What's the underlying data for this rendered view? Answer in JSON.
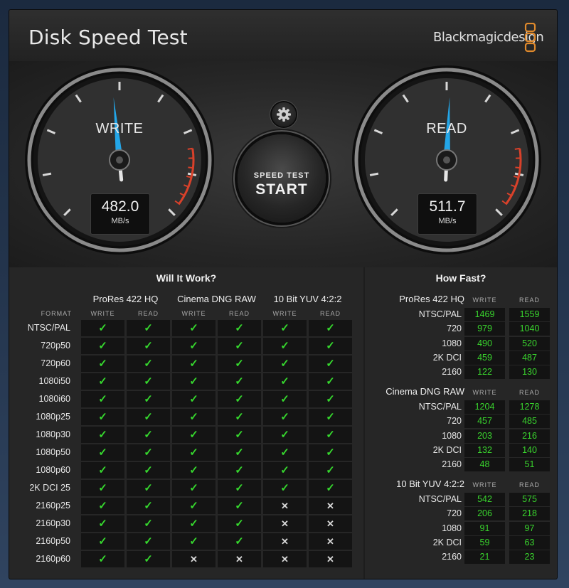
{
  "window": {
    "title": "Disk Speed Test",
    "brand": "Blackmagicdesign",
    "close_glyph": "×"
  },
  "gauges": {
    "write": {
      "label": "WRITE",
      "value": "482.0",
      "unit": "MB/s",
      "needle_fraction": 0.48
    },
    "read": {
      "label": "READ",
      "value": "511.7",
      "unit": "MB/s",
      "needle_fraction": 0.51
    }
  },
  "start_button": {
    "small": "SPEED TEST",
    "big": "START"
  },
  "settings_icon": "gear-icon",
  "will_it_work": {
    "title": "Will It Work?",
    "format_label": "FORMAT",
    "groups": [
      "ProRes 422 HQ",
      "Cinema DNG RAW",
      "10 Bit YUV 4:2:2"
    ],
    "sub": [
      "WRITE",
      "READ"
    ],
    "rows": [
      {
        "name": "NTSC/PAL",
        "v": [
          1,
          1,
          1,
          1,
          1,
          1
        ]
      },
      {
        "name": "720p50",
        "v": [
          1,
          1,
          1,
          1,
          1,
          1
        ]
      },
      {
        "name": "720p60",
        "v": [
          1,
          1,
          1,
          1,
          1,
          1
        ]
      },
      {
        "name": "1080i50",
        "v": [
          1,
          1,
          1,
          1,
          1,
          1
        ]
      },
      {
        "name": "1080i60",
        "v": [
          1,
          1,
          1,
          1,
          1,
          1
        ]
      },
      {
        "name": "1080p25",
        "v": [
          1,
          1,
          1,
          1,
          1,
          1
        ]
      },
      {
        "name": "1080p30",
        "v": [
          1,
          1,
          1,
          1,
          1,
          1
        ]
      },
      {
        "name": "1080p50",
        "v": [
          1,
          1,
          1,
          1,
          1,
          1
        ]
      },
      {
        "name": "1080p60",
        "v": [
          1,
          1,
          1,
          1,
          1,
          1
        ]
      },
      {
        "name": "2K DCI 25",
        "v": [
          1,
          1,
          1,
          1,
          1,
          1
        ]
      },
      {
        "name": "2160p25",
        "v": [
          1,
          1,
          1,
          1,
          0,
          0
        ]
      },
      {
        "name": "2160p30",
        "v": [
          1,
          1,
          1,
          1,
          0,
          0
        ]
      },
      {
        "name": "2160p50",
        "v": [
          1,
          1,
          1,
          1,
          0,
          0
        ]
      },
      {
        "name": "2160p60",
        "v": [
          1,
          1,
          0,
          0,
          0,
          0
        ]
      }
    ],
    "check_glyph": "✓",
    "cross_glyph": "✕"
  },
  "how_fast": {
    "title": "How Fast?",
    "sub": [
      "WRITE",
      "READ"
    ],
    "groups": [
      {
        "name": "ProRes 422 HQ",
        "rows": [
          [
            "NTSC/PAL",
            "1469",
            "1559"
          ],
          [
            "720",
            "979",
            "1040"
          ],
          [
            "1080",
            "490",
            "520"
          ],
          [
            "2K DCI",
            "459",
            "487"
          ],
          [
            "2160",
            "122",
            "130"
          ]
        ]
      },
      {
        "name": "Cinema DNG RAW",
        "rows": [
          [
            "NTSC/PAL",
            "1204",
            "1278"
          ],
          [
            "720",
            "457",
            "485"
          ],
          [
            "1080",
            "203",
            "216"
          ],
          [
            "2K DCI",
            "132",
            "140"
          ],
          [
            "2160",
            "48",
            "51"
          ]
        ]
      },
      {
        "name": "10 Bit YUV 4:2:2",
        "rows": [
          [
            "NTSC/PAL",
            "542",
            "575"
          ],
          [
            "720",
            "206",
            "218"
          ],
          [
            "1080",
            "91",
            "97"
          ],
          [
            "2K DCI",
            "59",
            "63"
          ],
          [
            "2160",
            "21",
            "23"
          ]
        ]
      }
    ]
  },
  "colors": {
    "accent_needle": "#23a6e8",
    "ok": "#36d82e",
    "redzone": "#d9412a"
  }
}
